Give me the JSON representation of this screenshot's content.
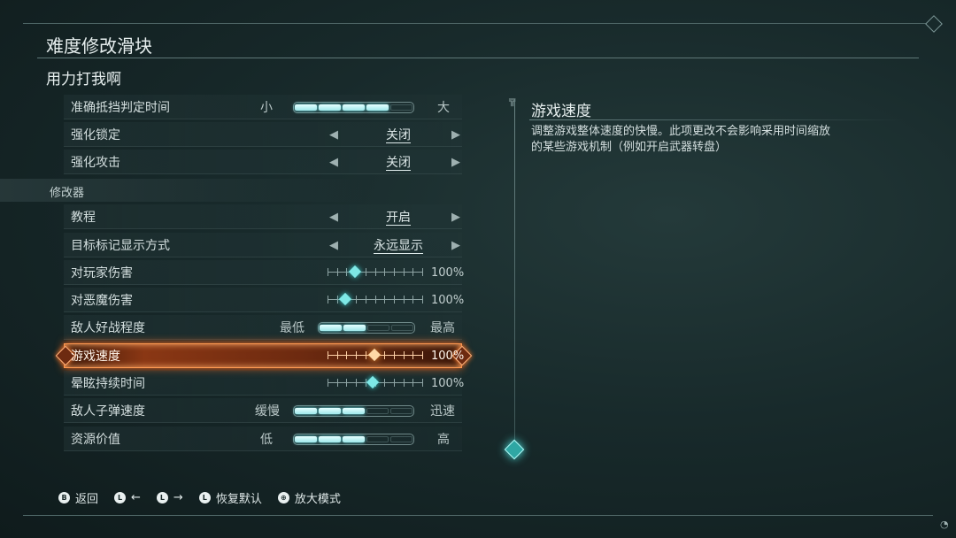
{
  "page_title": "难度修改滑块",
  "section_title": "用力打我啊",
  "category_label": "修改器",
  "rows": [
    {
      "label": "准确抵挡判定时间",
      "min": "小",
      "max": "大",
      "value_fraction": 0.8
    },
    {
      "label": "强化锁定",
      "value": "关闭"
    },
    {
      "label": "强化攻击",
      "value": "关闭"
    },
    {
      "label": "教程",
      "value": "开启"
    },
    {
      "label": "目标标记显示方式",
      "value": "永远显示"
    },
    {
      "label": "对玩家伤害",
      "pct": "100%"
    },
    {
      "label": "对恶魔伤害",
      "pct": "100%"
    },
    {
      "label": "敌人好战程度",
      "min": "最低",
      "max": "最高",
      "value_fraction": 0.4
    },
    {
      "label": "游戏速度",
      "pct": "100%",
      "selected": true
    },
    {
      "label": "晕眩持续时间",
      "pct": "100%"
    },
    {
      "label": "敌人子弹速度",
      "min": "缓慢",
      "max": "迅速",
      "value_fraction": 0.6
    },
    {
      "label": "资源价值",
      "min": "低",
      "max": "高",
      "value_fraction": 0.6
    }
  ],
  "description": {
    "title": "游戏速度",
    "text": "调整游戏整体速度的快慢。此项更改不会影响采用时间缩放的某些游戏机制（例如开启武器转盘）"
  },
  "footer": {
    "back": "返回",
    "left": "←",
    "right": "→",
    "reset": "恢复默认",
    "zoom": "放大模式",
    "back_key": "B",
    "l_key": "L",
    "zoom_key": "⊕"
  },
  "colors": {
    "accent": "#7ee8e6",
    "selected": "#ff9a52"
  }
}
